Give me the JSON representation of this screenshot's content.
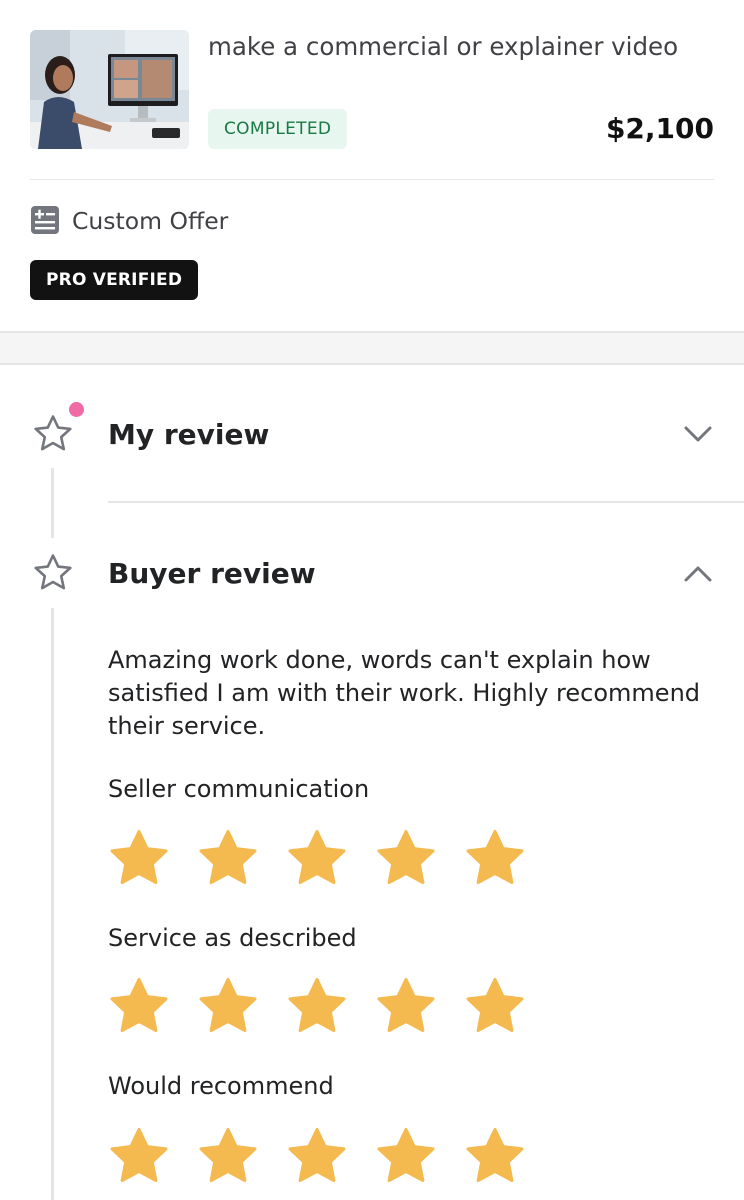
{
  "order": {
    "gig_title": "make a commercial or explainer video",
    "status": "COMPLETED",
    "price": "$2,100",
    "offer_type": "Custom Offer",
    "seller_badge": "PRO VERIFIED",
    "thumbnail_alt": "Seller working at a computer"
  },
  "reviews": {
    "my_review": {
      "heading": "My review",
      "expanded": false,
      "has_notification": true
    },
    "buyer_review": {
      "heading": "Buyer review",
      "expanded": true,
      "text": "Amazing work done, words can't explain how satisfied I am with their work. Highly recommend their service.",
      "ratings": [
        {
          "label": "Seller communication",
          "stars": 5
        },
        {
          "label": "Service as described",
          "stars": 5
        },
        {
          "label": "Would recommend",
          "stars": 5
        }
      ]
    }
  },
  "colors": {
    "star_fill": "#f4b94f",
    "status_bg": "#e7f6ee",
    "status_text": "#1a7a46",
    "notification_dot": "#f06ba5",
    "badge_bg": "#121212"
  }
}
